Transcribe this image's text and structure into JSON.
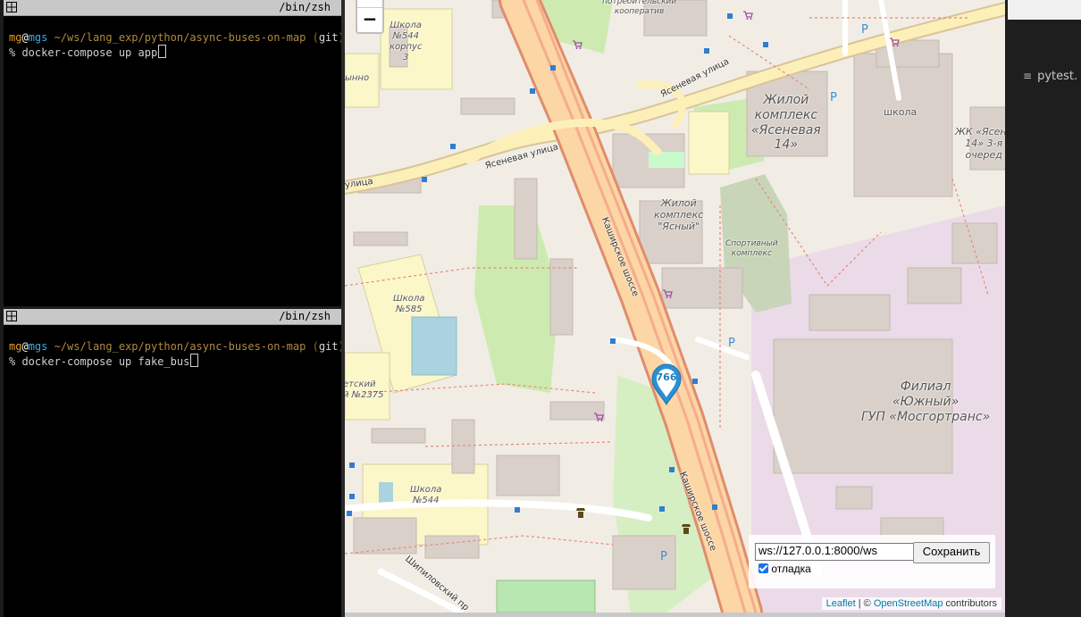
{
  "terminal_top": {
    "title": "/bin/zsh",
    "prompt_user": "mg",
    "prompt_at": "@",
    "prompt_host": "mgs",
    "prompt_path": " ~/ws/lang_exp/python/async-buses-on-map",
    "prompt_git_open": " (",
    "prompt_git": "git",
    "prompt_git_close": ")-",
    "prompt_symbol": "% ",
    "command": "docker-compose up app"
  },
  "terminal_bottom": {
    "title": "/bin/zsh",
    "prompt_user": "mg",
    "prompt_at": "@",
    "prompt_host": "mgs",
    "prompt_path": " ~/ws/lang_exp/python/async-buses-on-map",
    "prompt_git_open": " (",
    "prompt_git": "git",
    "prompt_git_close": ")-",
    "prompt_symbol": "% ",
    "command": "docker-compose up fake_bus"
  },
  "map": {
    "zoom_out": "−",
    "bus_marker": "766",
    "ws_url": "ws://127.0.0.1:8000/ws",
    "save_button": "Сохранить",
    "debug_label": "отладка",
    "attribution_leaflet": "Leaflet",
    "attribution_sep": " | © ",
    "attribution_osm": "OpenStreetMap",
    "attribution_tail": " contributors",
    "labels": {
      "coop": "потребительский\nкооператив",
      "school544k3": "Школа\n№544\nкорпус\n3",
      "yasenevaya_a": "Ясеневая улица",
      "yasenevaya_b": "Ясеневая улица",
      "ulitsa_left": "улица",
      "zhk_yaseneva": "Жилой\nкомплекс\n«Ясеневая\n14»",
      "school": "школа",
      "zhk_14_3": "ЖК «Ясене\n14» 3-я\nочеред",
      "zhk_yasny": "Жилой\nкомплекс\n\"Ясный\"",
      "sport": "Спортивный\nкомплекс",
      "kashirskoe_a": "Каширское шоссе",
      "kashirskoe_b": "Каширское шоссе",
      "school585": "Школа\n№585",
      "sad2375": "етский\nй №2375",
      "filial": "Филиал\n«Южный»\nГУП «Мосгортранс»",
      "school544": "Школа\n№544",
      "shipilovsky": "Шипиловский пр",
      "ynno": "ынно"
    }
  },
  "editor": {
    "tab_label": "pytest."
  },
  "colors": {
    "terminal_bg": "#000000",
    "user": "#e0a020",
    "host": "#3ea9e6",
    "map_bg": "#f1ede5",
    "motorway": "#f9b29c",
    "primary_road": "#fcd6a4",
    "park": "#c8facc",
    "industrial": "#ebdbe8",
    "marker": "#2b8fd6"
  }
}
